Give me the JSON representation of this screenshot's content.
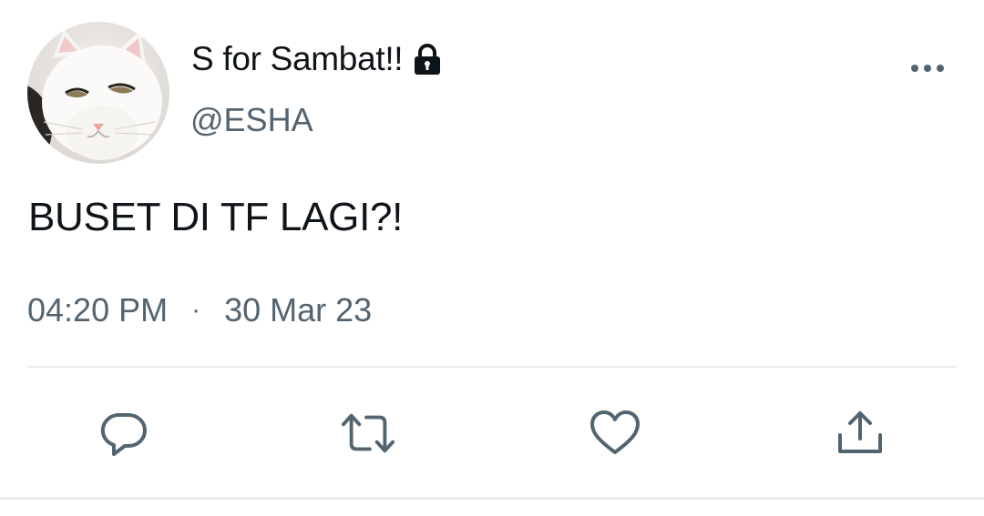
{
  "tweet": {
    "display_name": "S for Sambat!!",
    "handle": "@ESHA",
    "text": "BUSET DI TF LAGI?!",
    "time": "04:20 PM",
    "separator": "·",
    "date": "30 Mar 23"
  },
  "icons": {
    "lock": "lock-icon",
    "more": "more-icon",
    "reply": "reply-icon",
    "retweet": "retweet-icon",
    "like": "heart-icon",
    "share": "share-icon"
  },
  "colors": {
    "text_primary": "#0f1419",
    "text_secondary": "#536471",
    "icon": "#536471",
    "divider": "#e6ecf0"
  }
}
